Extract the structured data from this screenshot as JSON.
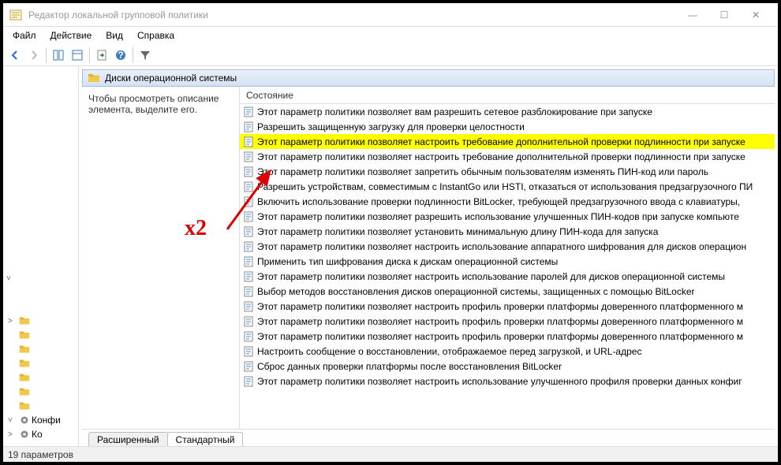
{
  "window": {
    "title": "Редактор локальной групповой политики"
  },
  "menu": {
    "file": "Файл",
    "action": "Действие",
    "view": "Вид",
    "help": "Справка"
  },
  "path": {
    "label": "Диски операционной системы"
  },
  "desc": {
    "line1": "Чтобы просмотреть описание",
    "line2": "элемента, выделите его."
  },
  "listheader": "Состояние",
  "items": [
    {
      "t": "Этот параметр политики позволяет вам разрешить сетевое разблокирование при запуске",
      "hl": false
    },
    {
      "t": "Разрешить защищенную загрузку для проверки целостности",
      "hl": false
    },
    {
      "t": "Этот параметр политики позволяет настроить требование дополнительной проверки подлинности при запуске",
      "hl": true
    },
    {
      "t": "Этот параметр политики позволяет настроить требование дополнительной проверки подлинности при запуске",
      "hl": false
    },
    {
      "t": "Этот параметр политики позволяет запретить обычным пользователям изменять ПИН-код или пароль",
      "hl": false
    },
    {
      "t": "Разрешить устройствам, совместимым с InstantGo или HSTI, отказаться от использования предзагрузочного ПИ",
      "hl": false
    },
    {
      "t": "Включить использование проверки подлинности BitLocker, требующей предзагрузочного ввода с клавиатуры,",
      "hl": false
    },
    {
      "t": "Этот параметр политики позволяет разрешить использование улучшенных ПИН-кодов при запуске компьюте",
      "hl": false
    },
    {
      "t": "Этот параметр политики позволяет установить минимальную длину ПИН-кода для запуска",
      "hl": false
    },
    {
      "t": "Этот параметр политики позволяет настроить использование аппаратного шифрования для дисков операцион",
      "hl": false
    },
    {
      "t": "Применить тип шифрования диска к дискам операционной системы",
      "hl": false
    },
    {
      "t": "Этот параметр политики позволяет настроить использование паролей для дисков операционной системы",
      "hl": false
    },
    {
      "t": "Выбор методов восстановления дисков операционной системы, защищенных с помощью BitLocker",
      "hl": false
    },
    {
      "t": "Этот параметр политики позволяет настроить профиль проверки платформы доверенного платформенного м",
      "hl": false
    },
    {
      "t": "Этот параметр политики позволяет настроить профиль проверки платформы доверенного платформенного м",
      "hl": false
    },
    {
      "t": "Этот параметр политики позволяет настроить профиль проверки платформы доверенного платформенного м",
      "hl": false
    },
    {
      "t": "Настроить сообщение о восстановлении, отображаемое перед загрузкой, и URL-адрес",
      "hl": false
    },
    {
      "t": "Сброс данных проверки платформы после восстановления BitLocker",
      "hl": false
    },
    {
      "t": "Этот параметр политики позволяет настроить использование улучшенного профиля проверки данных конфиг",
      "hl": false
    }
  ],
  "tree": [
    {
      "chev": "˅",
      "label": "",
      "icon": "chev-only"
    },
    {
      "chev": "",
      "label": "",
      "icon": "spacer"
    },
    {
      "chev": "",
      "label": "",
      "icon": "spacer"
    },
    {
      "chev": ">",
      "label": "",
      "icon": "folder"
    },
    {
      "chev": "",
      "label": "",
      "icon": "folder"
    },
    {
      "chev": "",
      "label": "",
      "icon": "folder"
    },
    {
      "chev": "",
      "label": "",
      "icon": "folder"
    },
    {
      "chev": "",
      "label": "",
      "icon": "folder"
    },
    {
      "chev": "",
      "label": "",
      "icon": "folder"
    },
    {
      "chev": "",
      "label": "",
      "icon": "folder-dot"
    },
    {
      "chev": "˅",
      "label": "Конфи",
      "icon": "gear"
    },
    {
      "chev": ">",
      "label": "Ко",
      "icon": "gear"
    }
  ],
  "tabs": {
    "extended": "Расширенный",
    "standard": "Стандартный"
  },
  "status": "19 параметров",
  "annotation": "x2"
}
